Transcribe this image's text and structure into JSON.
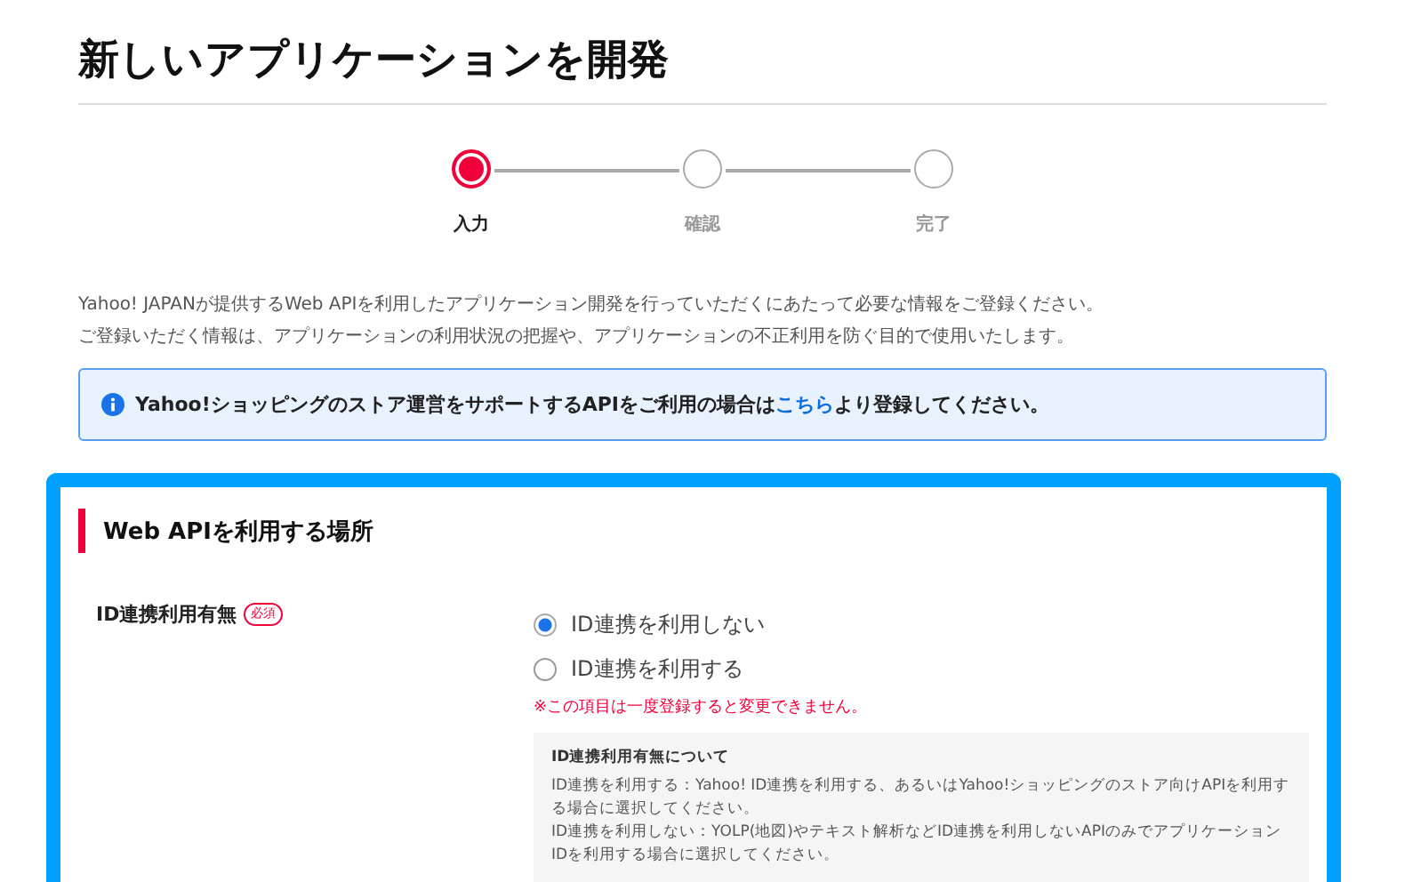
{
  "page": {
    "title": "新しいアプリケーションを開発"
  },
  "steps": [
    {
      "label": "入力",
      "selected": true
    },
    {
      "label": "確認",
      "selected": false
    },
    {
      "label": "完了",
      "selected": false
    }
  ],
  "intro": [
    "Yahoo! JAPANが提供するWeb APIを利用したアプリケーション開発を行っていただくにあたって必要な情報をご登録ください。",
    "ご登録いただく情報は、アプリケーションの利用状況の把握や、アプリケーションの不正利用を防ぐ目的で使用いたします。"
  ],
  "info": {
    "before": "Yahoo!ショッピングのストア運営をサポートするAPIをご利用の場合は",
    "link": "こちら",
    "after": "より登録してください。"
  },
  "section": {
    "heading": "Web APIを利用する場所",
    "field": {
      "label": "ID連携利用有無",
      "required": true,
      "required_badge": "必須",
      "options": [
        {
          "label": "ID連携を利用しない",
          "selected": true
        },
        {
          "label": "ID連携を利用する",
          "selected": false
        }
      ],
      "warning": "※この項目は一度登録すると変更できません。",
      "note": {
        "title": "ID連携利用有無について",
        "lines": [
          "ID連携を利用する：Yahoo! ID連携を利用する、あるいはYahoo!ショッピングのストア向けAPIを利用する場合に選択してください。",
          "ID連携を利用しない：YOLP(地図)やテキスト解析などID連携を利用しないAPIのみでアプリケーションIDを利用する場合に選択してください。"
        ]
      }
    }
  }
}
